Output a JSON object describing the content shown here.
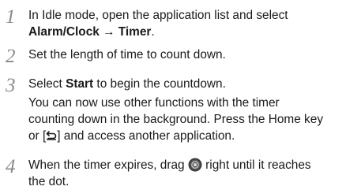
{
  "steps": [
    {
      "number": "1",
      "line1": "In Idle mode, open the application list and select",
      "path_part1": "Alarm/Clock",
      "path_arrow": "→",
      "path_part2": "Timer",
      "path_end": "."
    },
    {
      "number": "2",
      "text": "Set the length of time to count down."
    },
    {
      "number": "3",
      "pre": "Select ",
      "bold": "Start",
      "post": " to begin the countdown.",
      "note_line1": "You can now use other functions with the timer",
      "note_line2": "counting down in the background. Press the Home key",
      "note_line3_pre": "or [",
      "note_line3_post": "] and access another application."
    },
    {
      "number": "4",
      "pre": "When the timer expires, drag ",
      "post": " right until it reaches",
      "line2": "the dot."
    }
  ],
  "icons": {
    "back_key": "back-arrow-icon",
    "slider_handle": "timer-stop-handle-icon"
  }
}
